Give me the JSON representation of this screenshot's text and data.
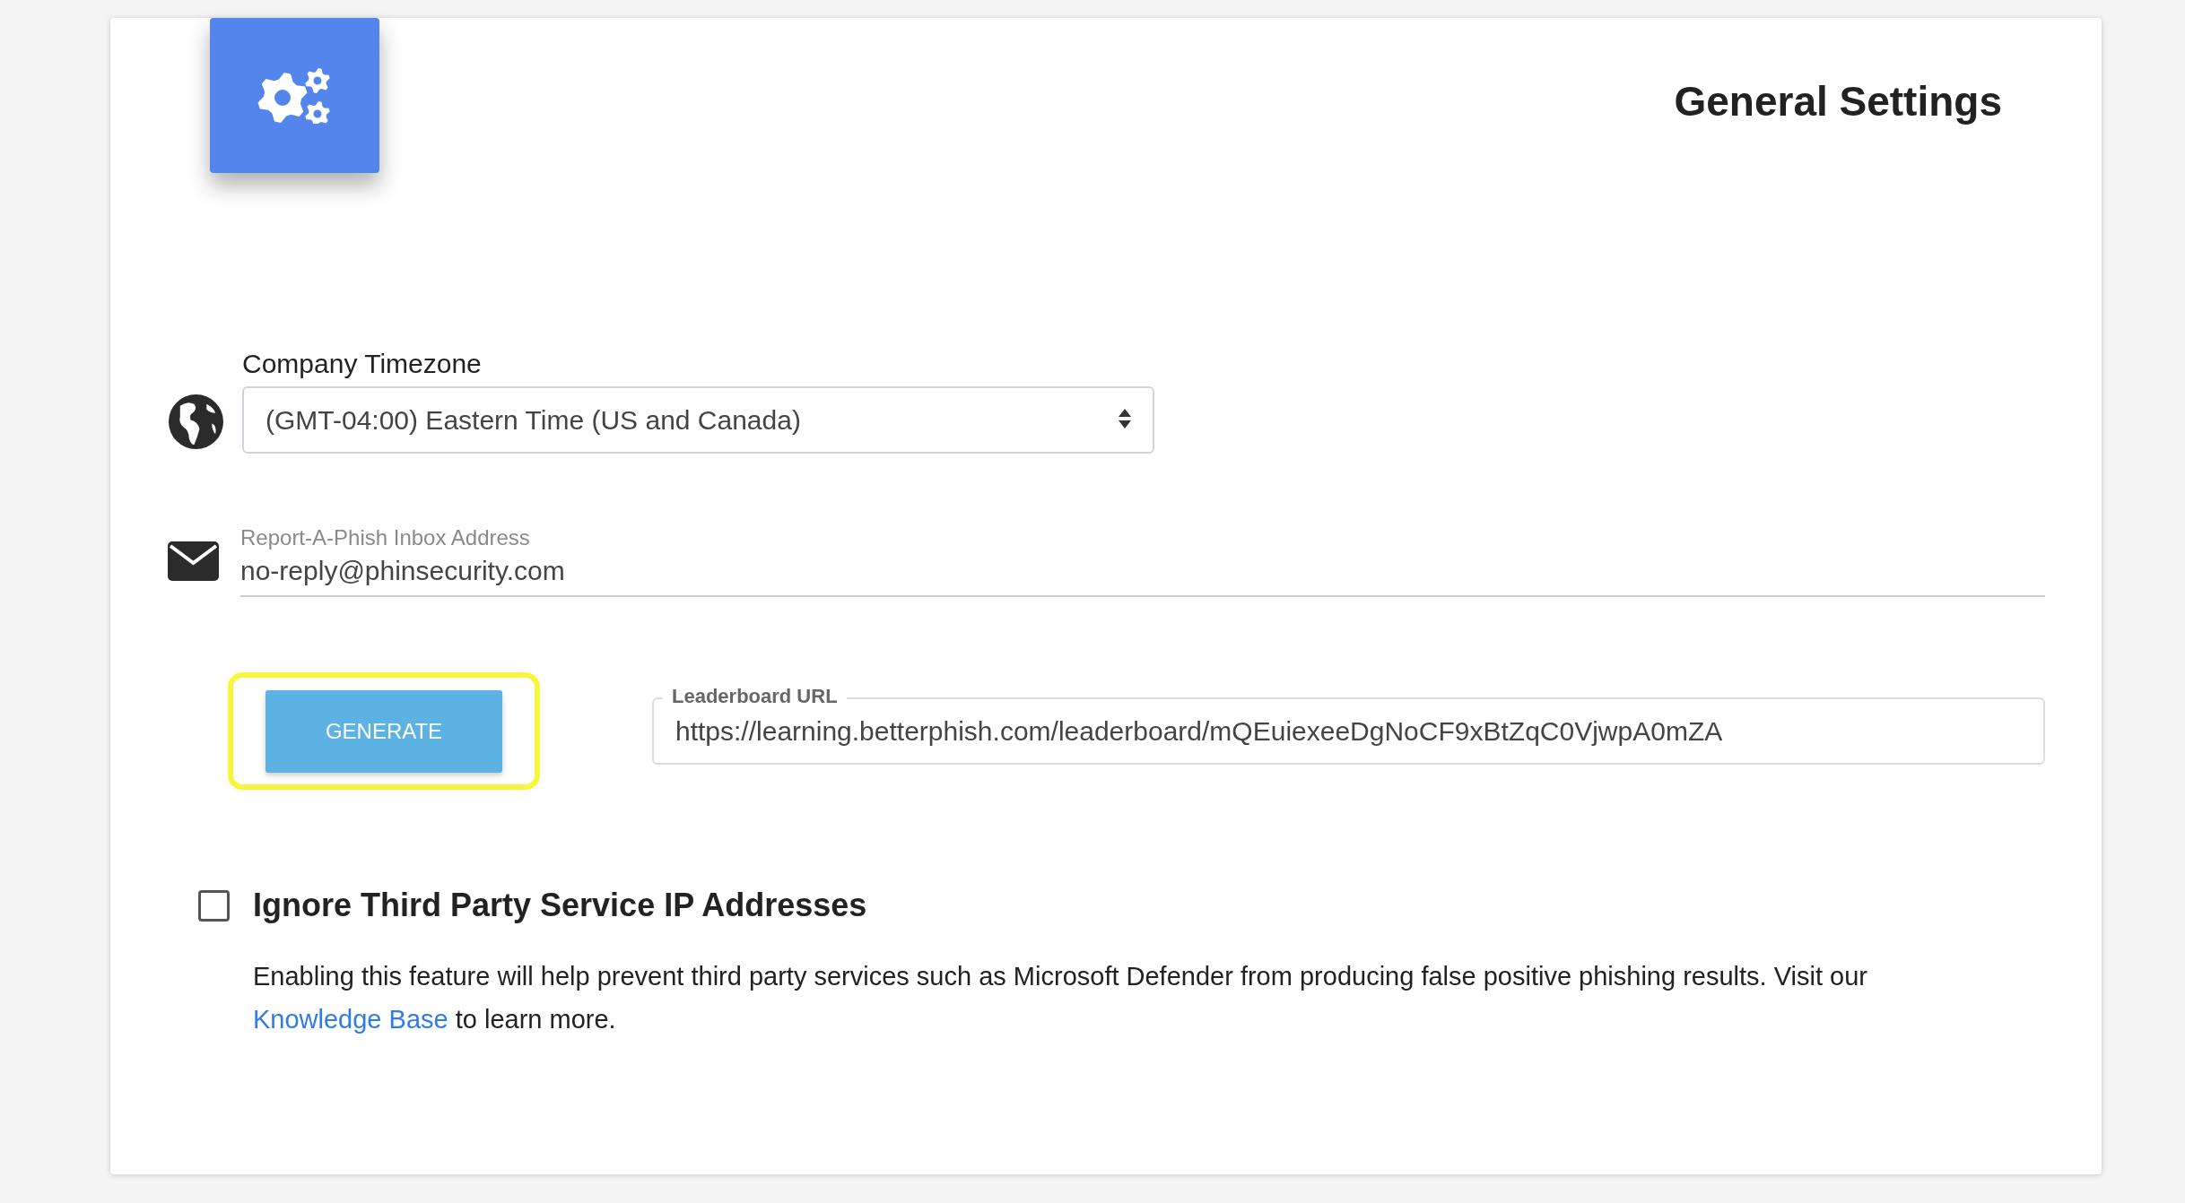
{
  "header": {
    "title": "General Settings"
  },
  "timezone": {
    "label": "Company Timezone",
    "value": "(GMT-04:00) Eastern Time (US and Canada)"
  },
  "inbox": {
    "label": "Report-A-Phish Inbox Address",
    "value": "no-reply@phinsecurity.com"
  },
  "leaderboard": {
    "button": "GENERATE",
    "highlighted": true,
    "label": "Leaderboard URL",
    "value": "https://learning.betterphish.com/leaderboard/mQEuiexeeDgNoCF9xBtZqC0VjwpA0mZA"
  },
  "ignore_third_party": {
    "label": "Ignore Third Party Service IP Addresses",
    "checked": false,
    "description": [
      {
        "kind": "text",
        "text": "Enabling this feature will help prevent third party services such as Microsoft Defender from producing false positive phishing results. Visit our "
      },
      {
        "kind": "link",
        "text": "Knowledge Base"
      },
      {
        "kind": "text",
        "text": " to learn more."
      }
    ]
  }
}
